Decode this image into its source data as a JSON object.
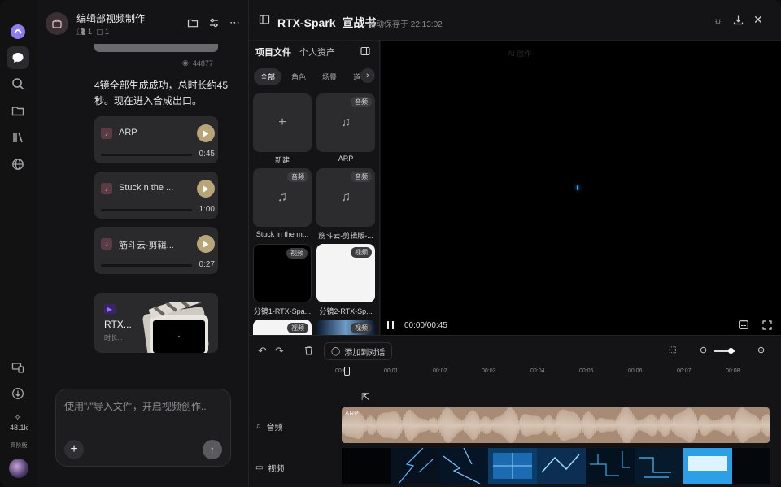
{
  "window": {
    "traffic": {
      "close": "#ff5f57",
      "min": "#febc2e",
      "max": "#28c840"
    }
  },
  "rail": {
    "stat_value": "48.1k",
    "stat_label": "高阶版"
  },
  "chat": {
    "title": "编辑部视频制作",
    "members": "1",
    "files": "1",
    "views": "44877",
    "message": "4镜全部生成成功，总时长约45秒。现在进入合成出口。",
    "audio_items": [
      {
        "name": "ARP",
        "duration": "0:45"
      },
      {
        "name": "Stuck  n the ...",
        "duration": "1:00"
      },
      {
        "name": "筋斗云-剪辑...",
        "duration": "0:27"
      }
    ],
    "video_card": {
      "title": "RTX...",
      "sub": "时长..."
    },
    "composer_placeholder": "使用\"/\"导入文件，开启视频创作..",
    "accent": "#b8a57a"
  },
  "editor": {
    "title": "RTX-Spark_宣战书",
    "saved": "自动保存于 22:13:02"
  },
  "assets": {
    "tab_project": "项目文件",
    "tab_personal": "个人资产",
    "filters": [
      "全部",
      "角色",
      "场景",
      "道"
    ],
    "items": [
      {
        "caption": "新建",
        "badge": "",
        "kind": "new"
      },
      {
        "caption": "ARP",
        "badge": "音频",
        "kind": "audio"
      },
      {
        "caption": "Stuck in the m...",
        "badge": "音频",
        "kind": "audio"
      },
      {
        "caption": "筋斗云-剪辑版-...",
        "badge": "音频",
        "kind": "audio"
      },
      {
        "caption": "分镜1-RTX-Spa...",
        "badge": "视频",
        "kind": "video-dark"
      },
      {
        "caption": "分镜2-RTX-Sp...",
        "badge": "视频",
        "kind": "video-light"
      },
      {
        "caption": "",
        "badge": "视频",
        "kind": "video-light"
      },
      {
        "caption": "",
        "badge": "视频",
        "kind": "video-blue"
      }
    ]
  },
  "preview": {
    "overlay_label": "AI 创作",
    "time": "00:00/00:45"
  },
  "timeline": {
    "add_to_chat": "添加到对话",
    "ticks": [
      "00:00",
      "00:01",
      "00:02",
      "00:03",
      "00:04",
      "00:05",
      "00:06",
      "00:07",
      "00:08"
    ],
    "audio_label": "音频",
    "video_label": "视频",
    "audio_clip": "ARP",
    "zoom": 0.7
  }
}
